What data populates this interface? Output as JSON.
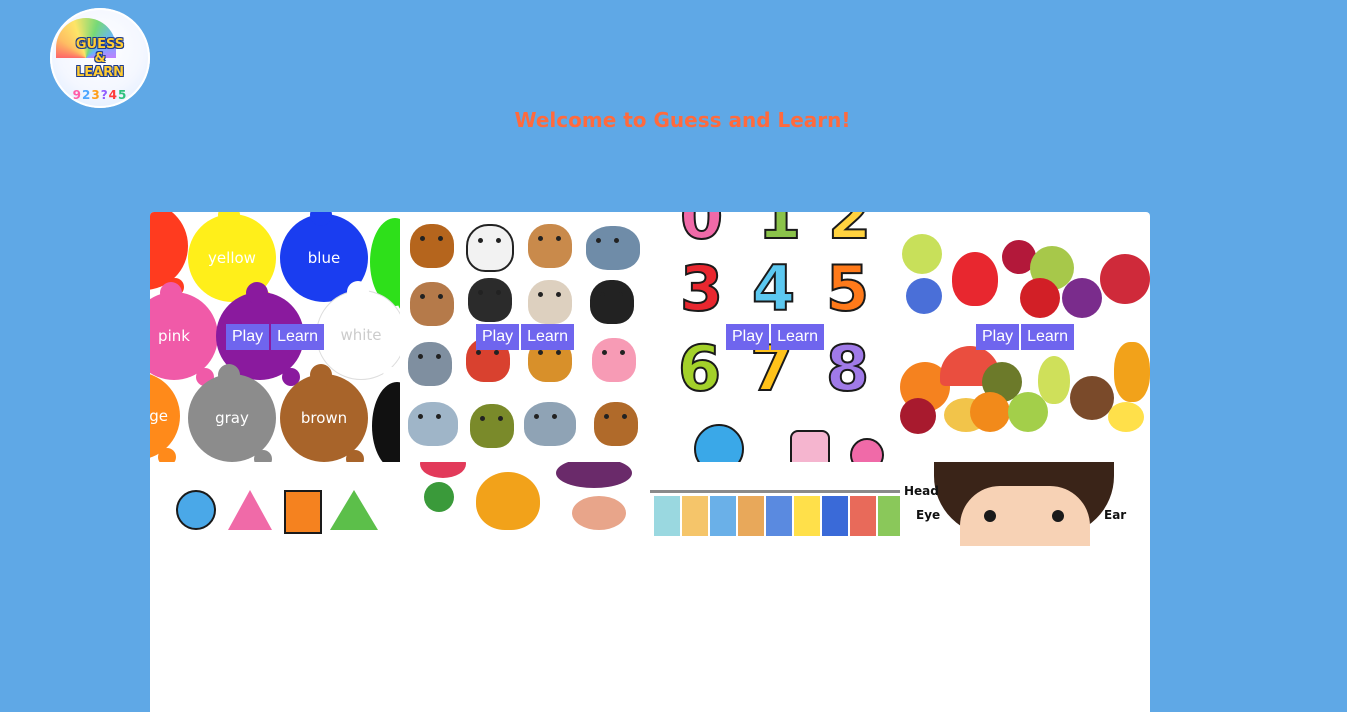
{
  "header": {
    "logo": {
      "title_line1": "GUESS",
      "title_line2": "&",
      "title_line3": "LEARN",
      "digits": [
        "9",
        "2",
        "3",
        "?",
        "4",
        "5"
      ]
    },
    "welcome_text": "Welcome to Guess and Learn!"
  },
  "cards": [
    {
      "topic": "colors",
      "play_label": "Play",
      "learn_label": "Learn",
      "art_labels": [
        "yellow",
        "blue",
        "pink",
        "white",
        "ge",
        "gray",
        "brown"
      ]
    },
    {
      "topic": "animals",
      "play_label": "Play",
      "learn_label": "Learn"
    },
    {
      "topic": "numbers",
      "play_label": "Play",
      "learn_label": "Learn",
      "art_digits": [
        "0",
        "1",
        "2",
        "3",
        "4",
        "5",
        "6",
        "7",
        "8"
      ]
    },
    {
      "topic": "fruits",
      "play_label": "Play",
      "learn_label": "Learn"
    },
    {
      "topic": "shapes"
    },
    {
      "topic": "vegetables"
    },
    {
      "topic": "clothes"
    },
    {
      "topic": "body-parts",
      "art_labels": [
        "Head",
        "Eye",
        "Ear"
      ]
    }
  ],
  "colors": {
    "background": "#5fa8e6",
    "welcome": "#ff6a3d",
    "button": "#6f65ee"
  }
}
